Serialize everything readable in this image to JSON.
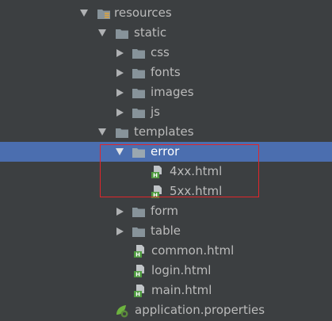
{
  "tree": {
    "resources": "resources",
    "static": "static",
    "css": "css",
    "fonts": "fonts",
    "images": "images",
    "js": "js",
    "templates": "templates",
    "error": "error",
    "file_4xx": "4xx.html",
    "file_5xx": "5xx.html",
    "form": "form",
    "table": "table",
    "common": "common.html",
    "login": "login.html",
    "main": "main.html",
    "application": "application.properties"
  },
  "colors": {
    "background": "#3c3f41",
    "selection": "#4b6eaf",
    "text": "#bbbbbb",
    "highlight_box": "#e0262b"
  },
  "icons": {
    "folder": "folder-icon",
    "resources_folder": "resources-folder-icon",
    "html_file": "html-file-icon",
    "properties_file": "spring-properties-icon"
  },
  "selected_item": "error"
}
